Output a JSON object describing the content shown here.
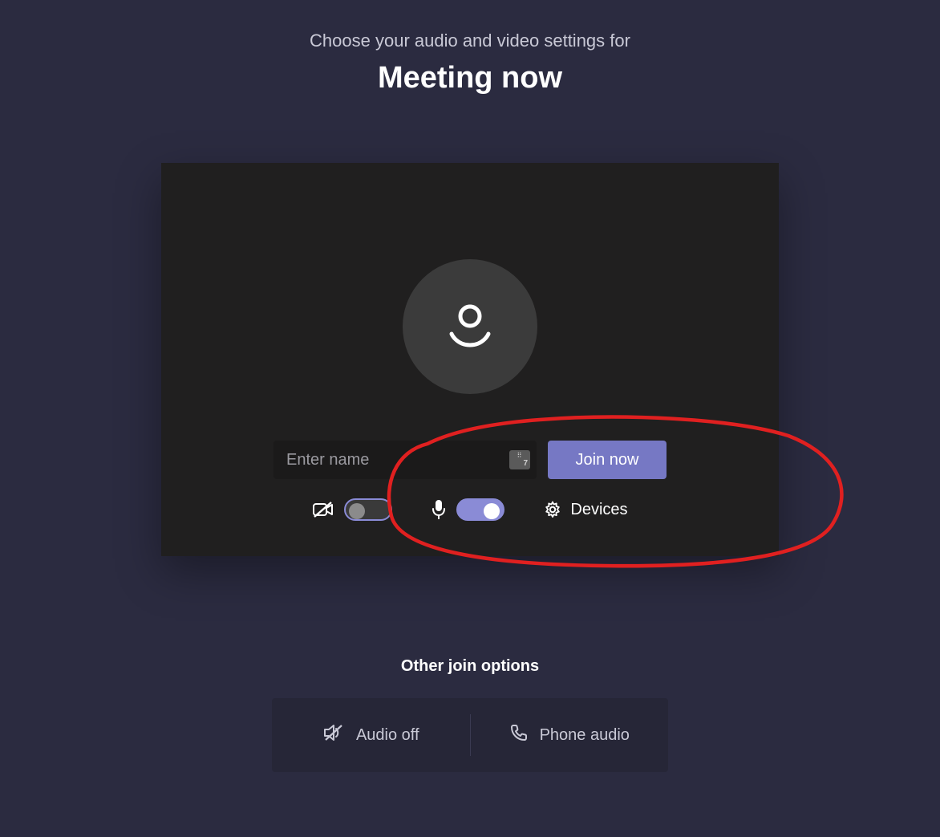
{
  "header": {
    "subtitle": "Choose your audio and video settings for",
    "title": "Meeting now"
  },
  "preview": {
    "name_placeholder": "Enter name",
    "name_value": "",
    "keyboard_badge_num": "7",
    "join_label": "Join now",
    "camera_on": false,
    "mic_on": true,
    "devices_label": "Devices"
  },
  "other": {
    "heading": "Other join options",
    "audio_off_label": "Audio off",
    "phone_audio_label": "Phone audio"
  },
  "colors": {
    "background": "#2b2b40",
    "card": "#201f1f",
    "accent": "#7678c4",
    "accent_light": "#8a8bd6",
    "annotation": "#e02020"
  }
}
